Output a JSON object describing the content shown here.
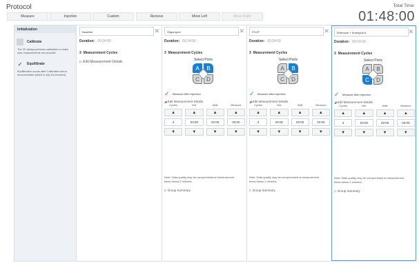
{
  "header": {
    "title": "Protocol",
    "total_time_label": "Total Time:",
    "total_time_value": "01:48:00"
  },
  "toolbar": {
    "measure": "Measure",
    "injection": "Injection",
    "custom": "Custom",
    "remove": "Remove",
    "move_left": "Move Left",
    "move_right": "Move Right"
  },
  "icons": {
    "close": "close-icon",
    "check": "check-icon",
    "caret": "caret-icon",
    "up": "up-arrow-icon",
    "down": "down-arrow-icon"
  },
  "init": {
    "heading": "Initialization",
    "calibrate": "Calibrate",
    "calibrate_note": "The XF always performs calibration to make sure measurements are accurate.",
    "equilibrate": "Equilibrate",
    "equilibrate_note": "Equilibration occurs after Calibration and is recommended (which is why it's checked)."
  },
  "columns": [
    {
      "name": "Baseline",
      "duration_label": "Duration:",
      "duration": "00:24:00",
      "cycles_count": "3",
      "cycles_label": "Measurement Cycles",
      "emd_label": "Edit Measurement Details"
    },
    {
      "name": "Oligomycin",
      "duration_label": "Duration:",
      "duration": "00:24:00",
      "cycles_count": "3",
      "cycles_label": "Measurement Cycles",
      "ports_label": "Select Ports",
      "ports": {
        "A": "A",
        "B": "B",
        "C": "C",
        "D": "D"
      },
      "mai_label": "Measure After Injection",
      "emd_label": "Edit Measurement Details",
      "headers": [
        "Cycles",
        "Mix",
        "Wait",
        "Measure"
      ],
      "values": [
        "3",
        "03:00",
        "02:00",
        "03:00"
      ],
      "note": "Note: Data quality may be compromised at measurement times below 2 minutes.",
      "group_summary": "Group Summary"
    },
    {
      "name": "FCCP",
      "duration_label": "Duration:",
      "duration": "00:24:00",
      "cycles_count": "3",
      "cycles_label": "Measurement Cycles",
      "ports_label": "Select Ports",
      "ports": {
        "A": "A",
        "B": "B",
        "C": "C",
        "D": "D"
      },
      "mai_label": "Measure After Injection",
      "emd_label": "Edit Measurement Details",
      "headers": [
        "Cycles",
        "Mix",
        "Wait",
        "Measure"
      ],
      "values": [
        "3",
        "03:00",
        "02:00",
        "03:00"
      ],
      "note": "Note: Data quality may be compromised at measurement times below 2 minutes.",
      "group_summary": "Group Summary"
    },
    {
      "name": "Rotenone + Antimycin A",
      "duration_label": "Duration:",
      "duration": "00:24:00",
      "cycles_count": "3",
      "cycles_label": "Measurement Cycles",
      "ports_label": "Select Ports",
      "ports": {
        "A": "A",
        "B": "B",
        "C": "C",
        "D": "D"
      },
      "mai_label": "Measure After Injection",
      "emd_label": "Edit Measurement Details",
      "headers": [
        "Cycles",
        "Mix",
        "Wait",
        "Measure"
      ],
      "values": [
        "3",
        "03:00",
        "02:00",
        "03:00"
      ],
      "note": "Note: Data quality may be compromised at measurement times below 2 minutes.",
      "group_summary": "Group Summary"
    }
  ],
  "colors": {
    "accent": "#1b7fd1",
    "panel": "#eef2f7"
  }
}
